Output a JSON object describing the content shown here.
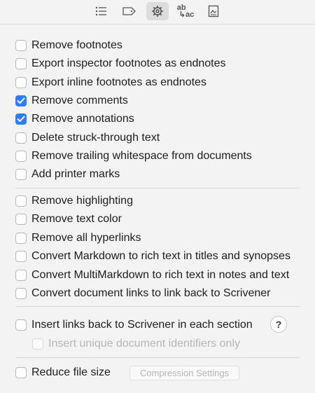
{
  "toolbar": {
    "icons": [
      "list-icon",
      "tag-icon",
      "gear-icon",
      "text-replace-icon",
      "document-icon"
    ],
    "active": "gear-icon",
    "replace_top": "ab",
    "replace_bottom": "↳ac"
  },
  "options": {
    "remove_footnotes": {
      "label": "Remove footnotes",
      "checked": false
    },
    "export_inspector_footnotes": {
      "label": "Export inspector footnotes as endnotes",
      "checked": false
    },
    "export_inline_footnotes": {
      "label": "Export inline footnotes as endnotes",
      "checked": false
    },
    "remove_comments": {
      "label": "Remove comments",
      "checked": true
    },
    "remove_annotations": {
      "label": "Remove annotations",
      "checked": true
    },
    "delete_struck_through": {
      "label": "Delete struck-through text",
      "checked": false
    },
    "remove_trailing_whitespace": {
      "label": "Remove trailing whitespace from documents",
      "checked": false
    },
    "add_printer_marks": {
      "label": "Add printer marks",
      "checked": false
    },
    "remove_highlighting": {
      "label": "Remove highlighting",
      "checked": false
    },
    "remove_text_color": {
      "label": "Remove text color",
      "checked": false
    },
    "remove_hyperlinks": {
      "label": "Remove all hyperlinks",
      "checked": false
    },
    "convert_markdown_titles": {
      "label": "Convert Markdown to rich text in titles and synopses",
      "checked": false
    },
    "convert_multimarkdown_notes": {
      "label": "Convert MultiMarkdown to rich text in notes and text",
      "checked": false
    },
    "convert_document_links": {
      "label": "Convert document links to link back to Scrivener",
      "checked": false
    },
    "insert_links_back": {
      "label": "Insert links back to Scrivener in each section",
      "checked": false
    },
    "insert_unique_ids": {
      "label": "Insert unique document identifiers only",
      "checked": false,
      "enabled": false
    },
    "reduce_file_size": {
      "label": "Reduce file size",
      "checked": false
    }
  },
  "help_label": "?",
  "compression_button": {
    "label": "Compression Settings",
    "enabled": false
  },
  "colors": {
    "accent": "#2f7cf6",
    "background": "#f3f3f3"
  }
}
